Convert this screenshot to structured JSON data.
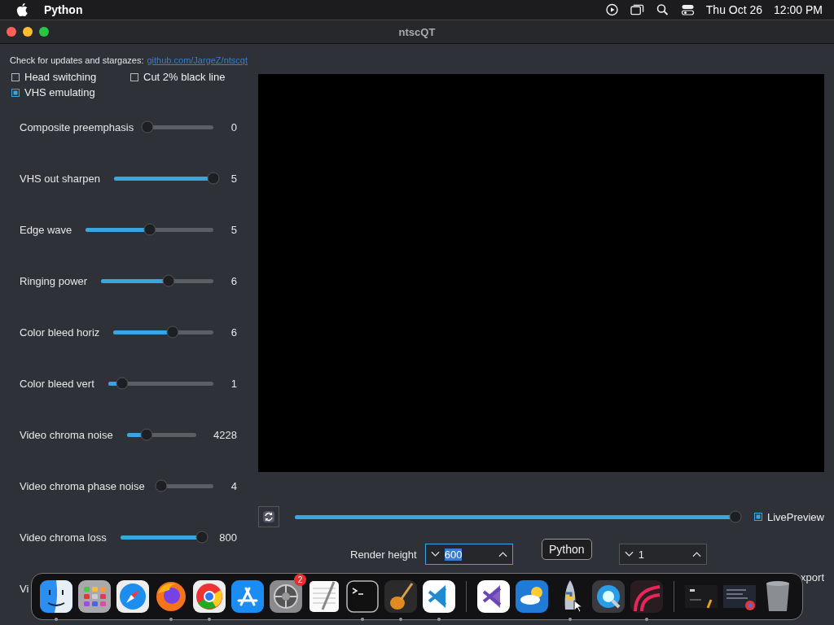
{
  "menu_bar": {
    "app_name": "Python",
    "date": "Thu Oct 26",
    "time": "12:00 PM"
  },
  "window": {
    "title": "ntscQT"
  },
  "header": {
    "text": "Check for updates and stargazes:",
    "link": "github.com/JargeZ/ntscqt"
  },
  "checkboxes": [
    {
      "label": "Head switching",
      "checked": false
    },
    {
      "label": "Cut 2% black line",
      "checked": false
    },
    {
      "label": "VHS emulating",
      "checked": true
    }
  ],
  "sliders": [
    {
      "label": "Composite preemphasis",
      "level": 0,
      "value": "0"
    },
    {
      "label": "VHS out sharpen",
      "level": 1,
      "value": "5"
    },
    {
      "label": "Edge wave",
      "level": 0.5,
      "value": "5"
    },
    {
      "label": "Ringing power",
      "level": 0.6,
      "value": "6"
    },
    {
      "label": "Color bleed horiz",
      "level": 0.59,
      "value": "6"
    },
    {
      "label": "Color bleed vert",
      "level": 0.13,
      "value": "1"
    },
    {
      "label": "Video chroma noise",
      "level": 0.29,
      "value": "4228"
    },
    {
      "label": "Video chroma phase noise",
      "level": 0.05,
      "value": "4"
    },
    {
      "label": "Video chroma loss",
      "level": 1,
      "value": "800"
    }
  ],
  "cut_label": "Vi",
  "timeline": {
    "level": 1
  },
  "live_preview": {
    "label": "LivePreview",
    "checked": true
  },
  "render_height": {
    "label": "Render height",
    "value": "600"
  },
  "second_spin": {
    "value": "1"
  },
  "export_fragment": "xport",
  "tooltip": "Python",
  "dock": [
    {
      "kind": "finder",
      "running": true
    },
    {
      "kind": "launchpad",
      "running": false
    },
    {
      "kind": "safari",
      "running": false
    },
    {
      "kind": "firefox",
      "running": true
    },
    {
      "kind": "chrome",
      "running": true
    },
    {
      "kind": "appstore",
      "running": false
    },
    {
      "kind": "settings",
      "running": false,
      "badge": "2"
    },
    {
      "kind": "textedit",
      "running": false
    },
    {
      "kind": "terminal",
      "running": true
    },
    {
      "kind": "garageband",
      "running": true
    },
    {
      "kind": "vscode",
      "running": true
    },
    {
      "kind": "divider"
    },
    {
      "kind": "visualstudio",
      "running": false
    },
    {
      "kind": "weather",
      "running": false
    },
    {
      "kind": "python",
      "running": true,
      "hovered": true
    },
    {
      "kind": "quicktime",
      "running": false
    },
    {
      "kind": "redapp",
      "running": true
    },
    {
      "kind": "divider"
    },
    {
      "kind": "window_thumb",
      "running": false
    },
    {
      "kind": "window_thumb2",
      "running": false
    },
    {
      "kind": "trash",
      "running": false
    }
  ]
}
